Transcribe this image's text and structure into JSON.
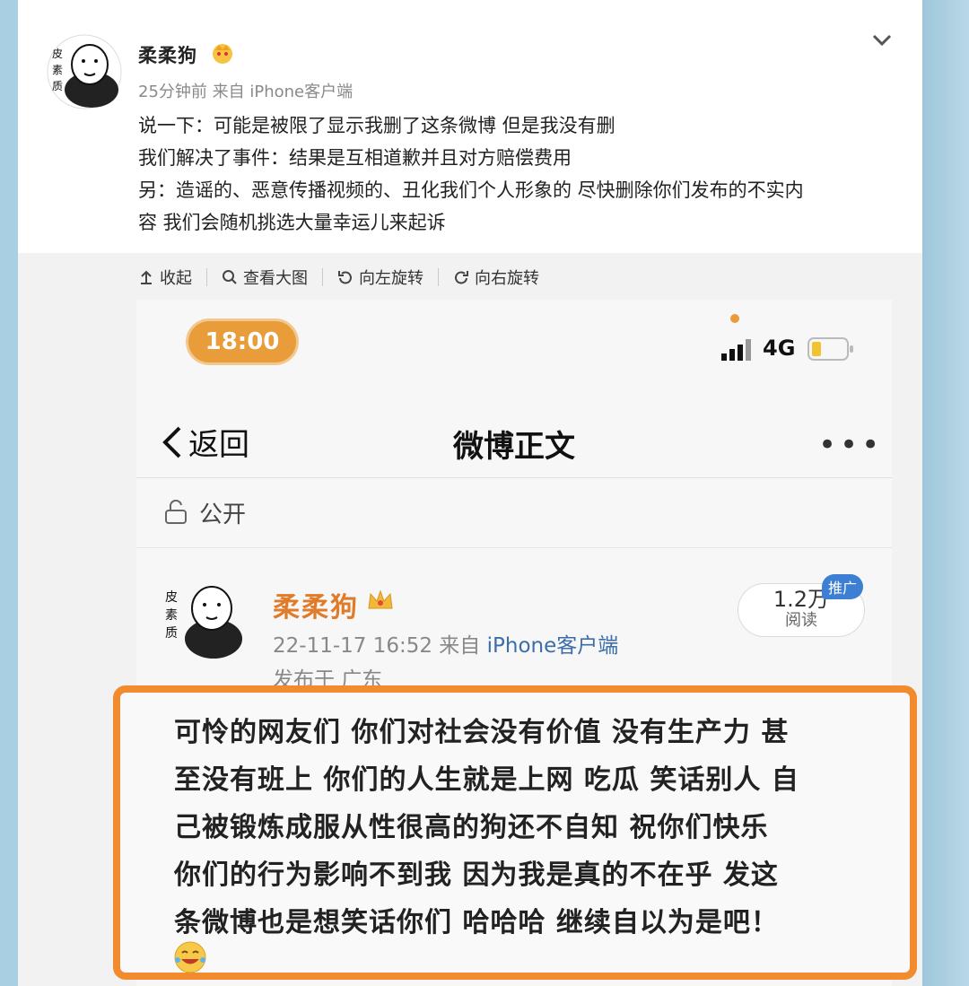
{
  "post": {
    "username": "柔柔狗",
    "meta": "25分钟前 来自 iPhone客户端",
    "lines": [
      "说一下：可能是被限了显示我删了这条微博 但是我没有删",
      "我们解决了事件：结果是互相道歉并且对方赔偿费用",
      "另：造谣的、恶意传播视频的、丑化我们个人形象的 尽快删除你们发布的不实内",
      "容 我们会随机挑选大量幸运儿来起诉"
    ]
  },
  "toolbar": {
    "collapse": "收起",
    "view_large": "查看大图",
    "rotate_left": "向左旋转",
    "rotate_right": "向右旋转"
  },
  "screenshot": {
    "time": "18:00",
    "network": "4G",
    "back_label": "返回",
    "nav_title": "微博正文",
    "more": "•••",
    "visibility": "公开",
    "username": "柔柔狗",
    "date": "22-11-17 16:52 来自",
    "client": "iPhone客户端",
    "location": "发布于 广东",
    "read_count": "1.2万",
    "read_label": "阅读",
    "promo_badge": "推广",
    "content_lines": [
      "可怜的网友们 你们对社会没有价值 没有生产力 甚",
      "至没有班上 你们的人生就是上网 吃瓜 笑话别人 自",
      "己被锻炼成服从性很高的狗还不自知 祝你们快乐",
      "你们的行为影响不到我 因为我是真的不在乎 发这",
      "条微博也是想笑话你们 哈哈哈 继续自以为是吧！"
    ]
  },
  "colors": {
    "highlight_border": "#f28b2e",
    "username_orange": "#e07b2a",
    "link_blue": "#3b6ea8",
    "time_pill": "#e89d3a"
  }
}
